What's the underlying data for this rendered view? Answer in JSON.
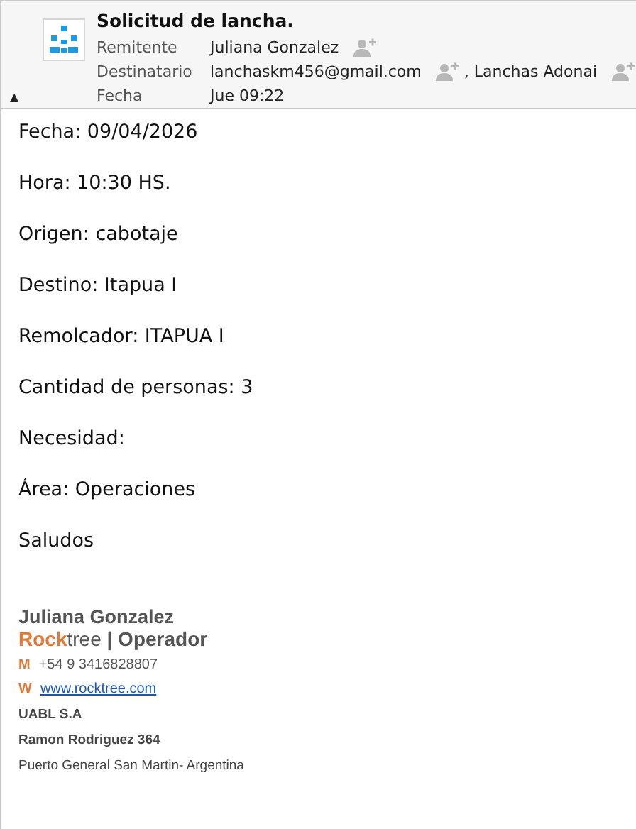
{
  "header": {
    "subject": "Solicitud de lancha.",
    "collapse_toggle": "▲",
    "fields": [
      {
        "label": "Remitente",
        "values": [
          {
            "text": "Juliana Gonzalez",
            "kind": "contact"
          }
        ]
      },
      {
        "label": "Destinatario",
        "values": [
          {
            "text": "lanchaskm456@gmail.com",
            "kind": "contact"
          },
          {
            "text": ", Lanchas Adonai",
            "kind": "contact"
          }
        ]
      },
      {
        "label": "Fecha",
        "values": [
          {
            "text": "Jue 09:22",
            "kind": "date"
          }
        ]
      }
    ]
  },
  "body": {
    "lines": [
      "Fecha: 09/04/2026",
      "Hora: 10:30 HS.",
      "Origen: cabotaje",
      "Destino: Itapua I",
      "Remolcador: ITAPUA I",
      "Cantidad de personas: 3",
      "Necesidad:",
      "Área: Operaciones",
      "Saludos"
    ]
  },
  "signature": {
    "name": "Juliana Gonzalez",
    "title_parts": [
      {
        "text": "Rock",
        "kind": "accent"
      },
      {
        "text": "tree",
        "kind": "plain"
      },
      {
        "text": " | Operador",
        "kind": "bold"
      }
    ],
    "contacts": [
      {
        "label": "M",
        "value": "+54 9 3416828807",
        "kind": "phone"
      },
      {
        "label": "W",
        "value": "www.rocktree.com",
        "kind": "link"
      }
    ],
    "address": [
      {
        "text": "UABL S.A",
        "bold": true
      },
      {
        "text": "Ramon Rodriguez 364",
        "bold": true
      },
      {
        "text": "Puerto General San Martin- Argentina",
        "bold": false
      }
    ]
  }
}
